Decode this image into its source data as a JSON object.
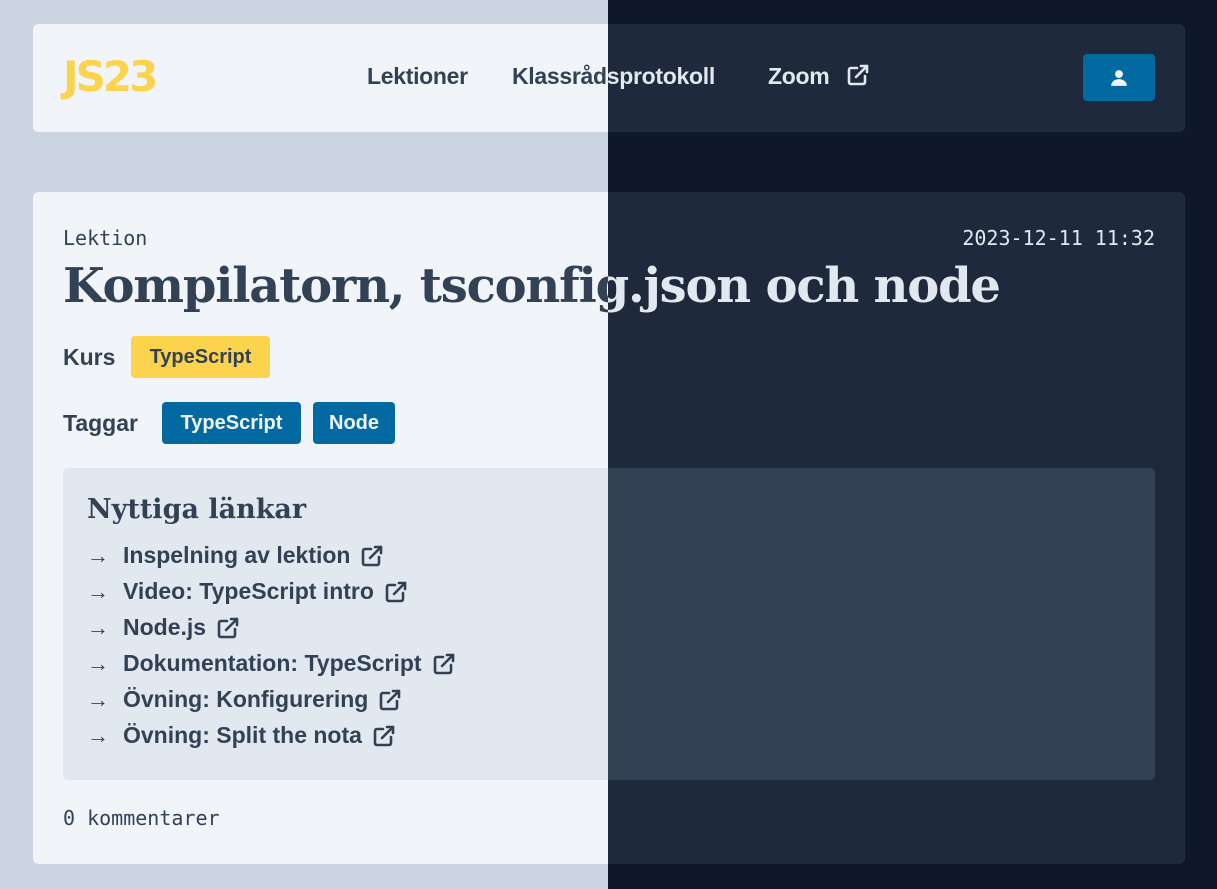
{
  "header": {
    "logo": "JS23",
    "nav": {
      "lektioner": "Lektioner",
      "klassrad": "Klassrådsprotokoll",
      "zoom": "Zoom"
    },
    "user_icon": "user-icon",
    "external_icon": "external-link-icon"
  },
  "lesson": {
    "kicker": "Lektion",
    "date": "2023-12-11 11:32",
    "title": "Kompilatorn, tsconfig.json och node",
    "kurs_label": "Kurs",
    "kurs": "TypeScript",
    "tags_label": "Taggar",
    "tags": [
      "TypeScript",
      "Node"
    ]
  },
  "links": {
    "title": "Nyttiga länkar",
    "items": [
      "Inspelning av lektion",
      "Video: TypeScript intro",
      "Node.js",
      "Dokumentation: TypeScript",
      "Övning: Konfigurering",
      "Övning: Split the nota"
    ]
  },
  "comments": "0 kommentarer",
  "colors": {
    "accent_yellow": "#fcd34d",
    "accent_blue": "#0369a1",
    "text_dark": "#334155",
    "text_light": "#e2e8f0"
  }
}
